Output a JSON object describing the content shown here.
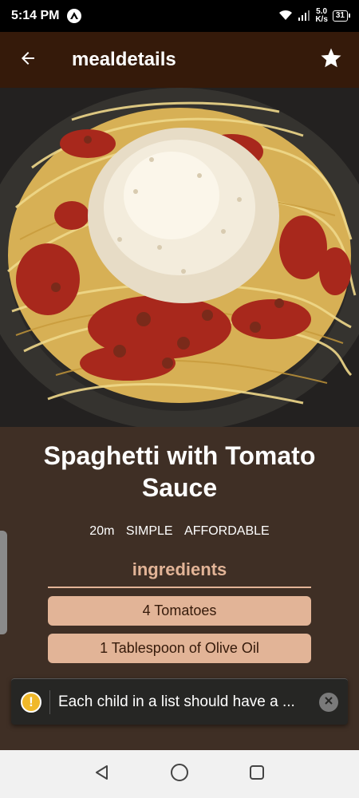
{
  "status_bar": {
    "time": "5:14 PM",
    "net_speed_value": "5.0",
    "net_speed_unit": "K/s",
    "battery": "31"
  },
  "app_bar": {
    "title": "mealdetails",
    "back_icon": "arrow-left-icon",
    "favorite_icon": "star-icon"
  },
  "meal": {
    "title": "Spaghetti with Tomato Sauce",
    "duration": "20m",
    "complexity": "SIMPLE",
    "affordability": "AFFORDABLE"
  },
  "ingredients": {
    "heading": "ingredients",
    "items": [
      "4 Tomatoes",
      "1 Tablespoon of Olive Oil"
    ]
  },
  "toast": {
    "message": "Each child in a list should have a ...",
    "icon": "warning-icon"
  },
  "colors": {
    "app_bar": "#351a0a",
    "background": "#3f2f25",
    "accent": "#e2b497"
  }
}
